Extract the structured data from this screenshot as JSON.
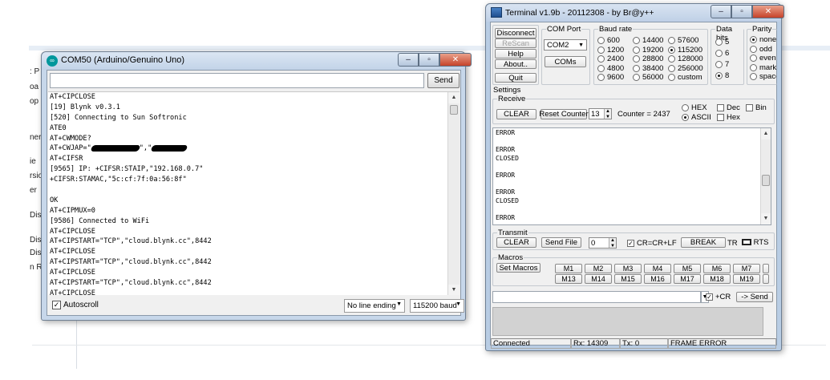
{
  "background": {
    "left_fragments": [
      ": P",
      "oa",
      "op",
      "ner",
      "ie",
      "rsio",
      "er",
      "Dis",
      "Dis",
      "Dis",
      "n R"
    ]
  },
  "arduino": {
    "title": "COM50 (Arduino/Genuino Uno)",
    "send_value": "",
    "send_label": "Send",
    "console_lines": [
      "AT+CIPCLOSE",
      "[19] Blynk v0.3.1",
      "[520] Connecting to Sun Softronic",
      "ATE0",
      "AT+CWMODE?",
      "AT+CWJAP=\"",
      "AT+CIFSR",
      "[9565] IP: +CIFSR:STAIP,\"192.168.0.7\"",
      "+CIFSR:STAMAC,\"5c:cf:7f:0a:56:8f\"",
      "",
      "OK",
      "AT+CIPMUX=0",
      "[9586] Connected to WiFi",
      "AT+CIPCLOSE",
      "AT+CIPSTART=\"TCP\",\"cloud.blynk.cc\",8442",
      "AT+CIPCLOSE",
      "AT+CIPSTART=\"TCP\",\"cloud.blynk.cc\",8442",
      "AT+CIPCLOSE",
      "AT+CIPSTART=\"TCP\",\"cloud.blynk.cc\",8442",
      "AT+CIPCLOSE"
    ],
    "cwjap_mid": "\",\"",
    "autoscroll_label": "Autoscroll",
    "autoscroll_checked": true,
    "line_ending": "No line ending",
    "baud": "115200 baud"
  },
  "terminal": {
    "title": "Terminal v1.9b - 20112308 - by Br@y++",
    "buttons": {
      "disconnect": "Disconnect",
      "rescan": "ReScan",
      "help": "Help",
      "about": "About..",
      "quit": "Quit",
      "coms": "COMs"
    },
    "com_port": {
      "label": "COM Port",
      "value": "COM2"
    },
    "baud_rate": {
      "label": "Baud rate",
      "options": [
        "600",
        "1200",
        "2400",
        "4800",
        "9600",
        "14400",
        "19200",
        "28800",
        "38400",
        "56000",
        "57600",
        "115200",
        "128000",
        "256000",
        "custom"
      ],
      "selected": "115200"
    },
    "data_bits": {
      "label": "Data bits",
      "options": [
        "5",
        "6",
        "7",
        "8"
      ],
      "selected": "8"
    },
    "parity": {
      "label": "Parity",
      "options": [
        "none",
        "odd",
        "even",
        "mark",
        "space"
      ],
      "selected": "none"
    },
    "settings_label": "Settings",
    "receive": {
      "label": "Receive",
      "clear": "CLEAR",
      "reset_counter": "Reset Counter",
      "counter_spin": "13",
      "counter_text": "Counter = 2437",
      "hex": "HEX",
      "ascii": "ASCII",
      "dec": "Dec",
      "bin": "Bin",
      "hex2": "Hex",
      "lines": [
        "ERROR",
        "",
        "ERROR",
        "CLOSED",
        "",
        "ERROR",
        "",
        "ERROR",
        "CLOSED",
        "",
        "ERROR"
      ]
    },
    "transmit": {
      "label": "Transmit",
      "clear": "CLEAR",
      "send_file": "Send File",
      "spin": "0",
      "crlf": "CR=CR+LF",
      "break": "BREAK",
      "tr": "TR",
      "rts": "RTS"
    },
    "macros": {
      "label": "Macros",
      "set_macros": "Set Macros",
      "row1": [
        "M1",
        "M2",
        "M3",
        "M4",
        "M5",
        "M6",
        "M7"
      ],
      "row2": [
        "M13",
        "M14",
        "M15",
        "M16",
        "M17",
        "M18",
        "M19"
      ]
    },
    "send_row": {
      "cr_label": "+CR",
      "send": "-> Send"
    },
    "status": {
      "connection": "Connected",
      "rx": "Rx: 14309",
      "tx": "Tx: 0",
      "error": "FRAME ERROR"
    }
  }
}
